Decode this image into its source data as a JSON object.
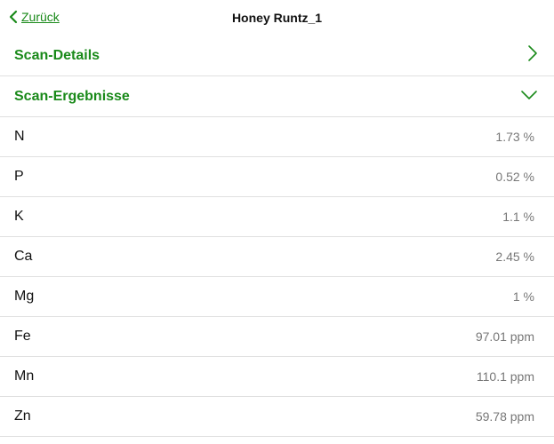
{
  "nav": {
    "back_label": "Zurück",
    "title": "Honey Runtz_1"
  },
  "sections": {
    "details_label": "Scan-Details",
    "results_label": "Scan-Ergebnisse"
  },
  "colors": {
    "accent": "#1a8a1a",
    "divider": "#e0e0e0",
    "value_text": "#777777"
  },
  "results": [
    {
      "label": "N",
      "value": "1.73 %"
    },
    {
      "label": "P",
      "value": "0.52 %"
    },
    {
      "label": "K",
      "value": "1.1 %"
    },
    {
      "label": "Ca",
      "value": "2.45 %"
    },
    {
      "label": "Mg",
      "value": "1 %"
    },
    {
      "label": "Fe",
      "value": "97.01 ppm"
    },
    {
      "label": "Mn",
      "value": "110.1 ppm"
    },
    {
      "label": "Zn",
      "value": "59.78 ppm"
    }
  ]
}
